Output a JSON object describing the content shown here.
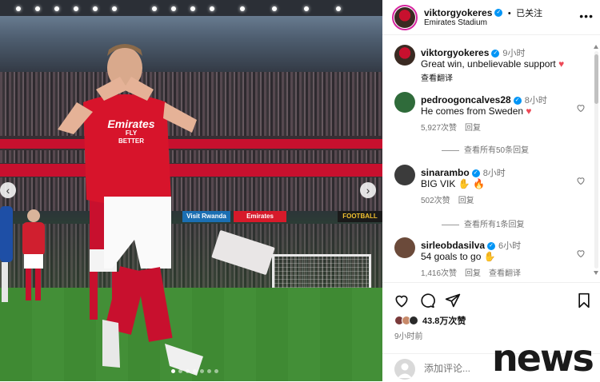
{
  "post": {
    "username": "viktorgyokeres",
    "follow_status": "已关注",
    "location": "Emirates Stadium",
    "caption": {
      "username": "viktorgyokeres",
      "time": "9小时",
      "text": "Great win, unbelievable support",
      "translate": "查看翻译"
    },
    "likes": "43.8万次赞",
    "time_ago": "9小时前",
    "add_comment_placeholder": "添加评论..."
  },
  "photo": {
    "ad_boards": [
      "Visit Rwanda",
      "Emirates",
      "FOOTBALL"
    ],
    "jersey_sponsor": "Emirates",
    "jersey_sponsor_sub": "FLY BETTER"
  },
  "comments": [
    {
      "username": "pedroogoncalves28",
      "time": "8小时",
      "text": "He comes from Sweden",
      "likes": "5,927次赞",
      "reply": "回复",
      "view_replies": "查看所有50条回复",
      "avatar_color": "#2f6b3a"
    },
    {
      "username": "sinarambo",
      "time": "8小时",
      "text": "BIG VIK",
      "likes": "502次赞",
      "reply": "回复",
      "view_replies": "查看所有1条回复",
      "avatar_color": "#3b3b3b"
    },
    {
      "username": "sirleobdasilva",
      "time": "6小时",
      "text": "54 goals to go",
      "likes": "1,416次赞",
      "reply": "回复",
      "translate": "查看翻译",
      "avatar_color": "#6b4a3a"
    }
  ],
  "watermark": "news",
  "colors": {
    "accent": "#0095f6",
    "heart": "#ed4956",
    "muted": "#737373",
    "arsenal_red": "#c8102e"
  }
}
